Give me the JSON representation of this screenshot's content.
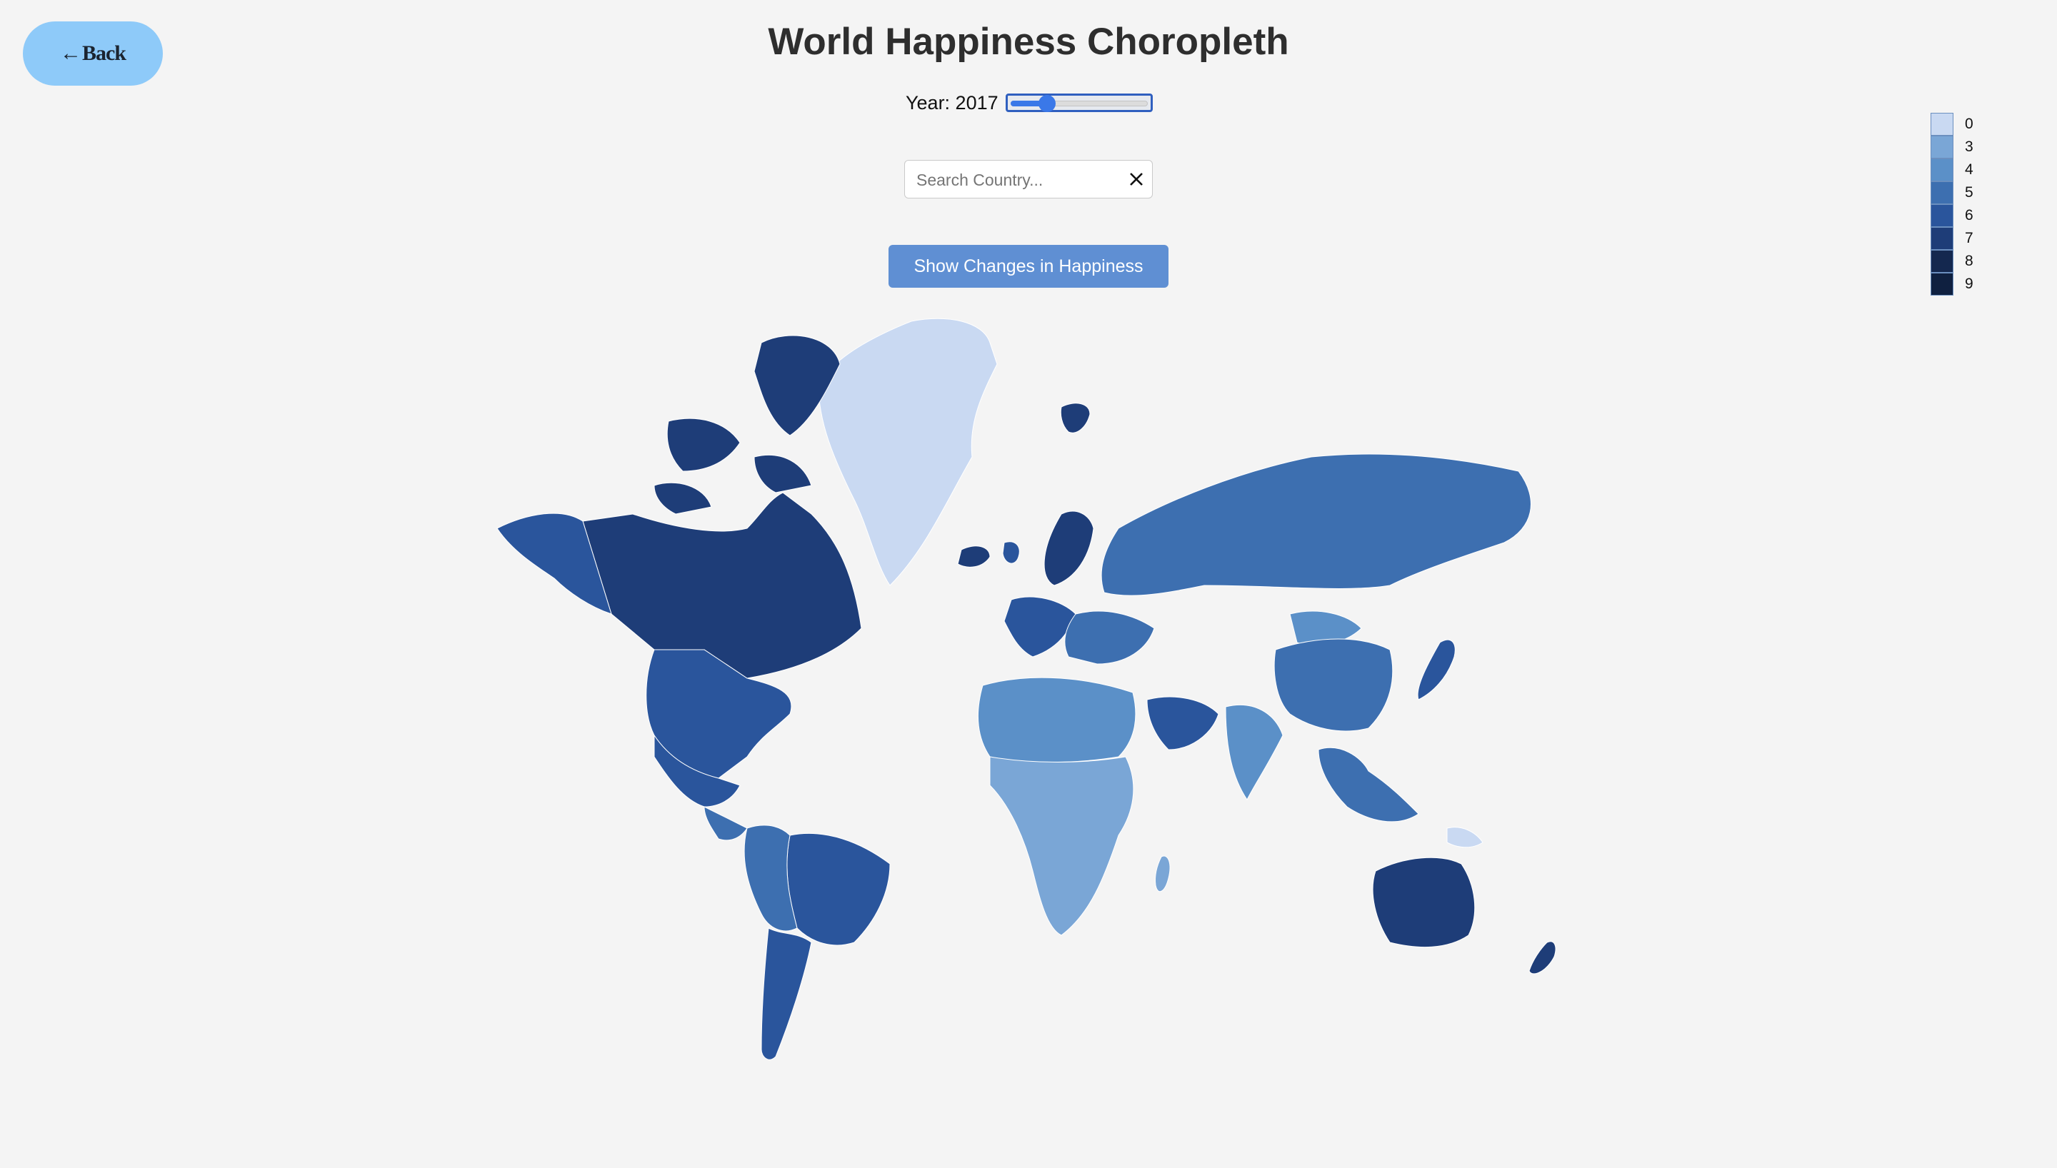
{
  "nav": {
    "back_label": "Back"
  },
  "header": {
    "title": "World Happiness Choropleth"
  },
  "year_control": {
    "label": "Year: 2017",
    "slider_fraction": 0.27
  },
  "search": {
    "placeholder": "Search Country...",
    "value": ""
  },
  "actions": {
    "changes_label": "Show Changes in Happiness"
  },
  "legend": {
    "items": [
      {
        "label": "0",
        "color": "#c9d9f2"
      },
      {
        "label": "3",
        "color": "#7aa6d6"
      },
      {
        "label": "4",
        "color": "#5b90c8"
      },
      {
        "label": "5",
        "color": "#3d6fb0"
      },
      {
        "label": "6",
        "color": "#2a559c"
      },
      {
        "label": "7",
        "color": "#1e3d78"
      },
      {
        "label": "8",
        "color": "#14284f"
      },
      {
        "label": "9",
        "color": "#0f2040"
      }
    ]
  },
  "regions": [
    {
      "name": "Greenland",
      "color": "#c9d9f2"
    },
    {
      "name": "Canada",
      "color": "#1e3d78"
    },
    {
      "name": "Alaska",
      "color": "#2a559c"
    },
    {
      "name": "United States",
      "color": "#2a559c"
    },
    {
      "name": "Mexico",
      "color": "#2a559c"
    },
    {
      "name": "Central America",
      "color": "#3d6fb0"
    },
    {
      "name": "Brazil",
      "color": "#2a559c"
    },
    {
      "name": "Andean South America",
      "color": "#3d6fb0"
    },
    {
      "name": "Southern Cone",
      "color": "#2a559c"
    },
    {
      "name": "Iceland",
      "color": "#1e3d78"
    },
    {
      "name": "Scandinavia",
      "color": "#1e3d78"
    },
    {
      "name": "Western Europe",
      "color": "#2a559c"
    },
    {
      "name": "Eastern Europe",
      "color": "#3d6fb0"
    },
    {
      "name": "Russia",
      "color": "#3d6fb0"
    },
    {
      "name": "Mongolia",
      "color": "#5b90c8"
    },
    {
      "name": "China",
      "color": "#3d6fb0"
    },
    {
      "name": "Arabian Peninsula",
      "color": "#2a559c"
    },
    {
      "name": "South Asia",
      "color": "#5b90c8"
    },
    {
      "name": "North Africa",
      "color": "#5b90c8"
    },
    {
      "name": "Sub-Saharan Africa",
      "color": "#7aa6d6"
    },
    {
      "name": "Madagascar",
      "color": "#7aa6d6"
    },
    {
      "name": "Southeast Asia",
      "color": "#3d6fb0"
    },
    {
      "name": "Japan",
      "color": "#2a559c"
    },
    {
      "name": "Australia",
      "color": "#1e3d78"
    },
    {
      "name": "New Zealand",
      "color": "#1e3d78"
    },
    {
      "name": "Papua New Guinea",
      "color": "#c9d9f2"
    }
  ]
}
